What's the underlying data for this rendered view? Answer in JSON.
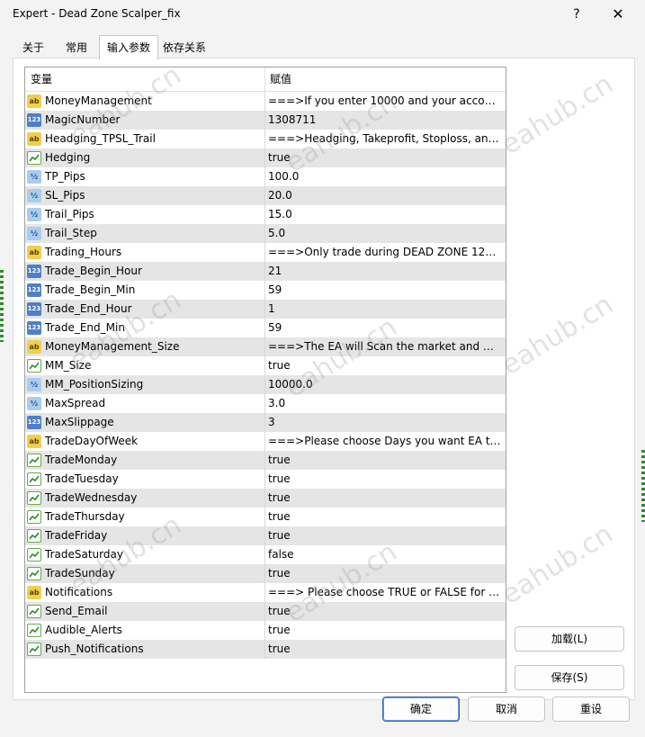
{
  "window": {
    "title": "Expert - Dead Zone Scalper_fix",
    "help_label": "?",
    "close_label": "✕"
  },
  "tabs": [
    {
      "label": "关于"
    },
    {
      "label": "常用"
    },
    {
      "label": "输入参数",
      "active": true
    },
    {
      "label": "依存关系"
    }
  ],
  "grid": {
    "col_variable": "变量",
    "col_value": "赋值",
    "rows": [
      {
        "type": "string",
        "name": "MoneyManagement",
        "value": "===>If you enter 10000 and your account..."
      },
      {
        "type": "int",
        "name": "MagicNumber",
        "value": "1308711"
      },
      {
        "type": "string",
        "name": "Headging_TPSL_Trail",
        "value": "===>Headging, Takeprofit, Stoploss, and ..."
      },
      {
        "type": "bool",
        "name": "Hedging",
        "value": "true"
      },
      {
        "type": "double",
        "name": "TP_Pips",
        "value": "100.0"
      },
      {
        "type": "double",
        "name": "SL_Pips",
        "value": "20.0"
      },
      {
        "type": "double",
        "name": "Trail_Pips",
        "value": "15.0"
      },
      {
        "type": "double",
        "name": "Trail_Step",
        "value": "5.0"
      },
      {
        "type": "string",
        "name": "Trading_Hours",
        "value": "===>Only trade during DEAD ZONE 12p..."
      },
      {
        "type": "int",
        "name": "Trade_Begin_Hour",
        "value": "21"
      },
      {
        "type": "int",
        "name": "Trade_Begin_Min",
        "value": "59"
      },
      {
        "type": "int",
        "name": "Trade_End_Hour",
        "value": "1"
      },
      {
        "type": "int",
        "name": "Trade_End_Min",
        "value": "59"
      },
      {
        "type": "string",
        "name": "MoneyManagement_Size",
        "value": "===>The EA will Scan the market and will ..."
      },
      {
        "type": "bool",
        "name": "MM_Size",
        "value": "true"
      },
      {
        "type": "double",
        "name": "MM_PositionSizing",
        "value": "10000.0"
      },
      {
        "type": "double",
        "name": "MaxSpread",
        "value": "3.0"
      },
      {
        "type": "int",
        "name": "MaxSlippage",
        "value": "3"
      },
      {
        "type": "string",
        "name": "TradeDayOfWeek",
        "value": "===>Please choose Days you want EA to ..."
      },
      {
        "type": "bool",
        "name": "TradeMonday",
        "value": "true"
      },
      {
        "type": "bool",
        "name": "TradeTuesday",
        "value": "true"
      },
      {
        "type": "bool",
        "name": "TradeWednesday",
        "value": "true"
      },
      {
        "type": "bool",
        "name": "TradeThursday",
        "value": "true"
      },
      {
        "type": "bool",
        "name": "TradeFriday",
        "value": "true"
      },
      {
        "type": "bool",
        "name": "TradeSaturday",
        "value": "false"
      },
      {
        "type": "bool",
        "name": "TradeSunday",
        "value": "true"
      },
      {
        "type": "string",
        "name": "Notifications",
        "value": "===> Please choose TRUE or FALSE for y..."
      },
      {
        "type": "bool",
        "name": "Send_Email",
        "value": "true"
      },
      {
        "type": "bool",
        "name": "Audible_Alerts",
        "value": "true"
      },
      {
        "type": "bool",
        "name": "Push_Notifications",
        "value": "true"
      }
    ]
  },
  "buttons": {
    "load": "加载(L)",
    "save": "保存(S)",
    "ok": "确定",
    "cancel": "取消",
    "reset": "重设"
  },
  "watermark": "eahub.cn",
  "colors": {
    "accent": "#2b63b8",
    "row_alt": "#e5e5e5"
  }
}
